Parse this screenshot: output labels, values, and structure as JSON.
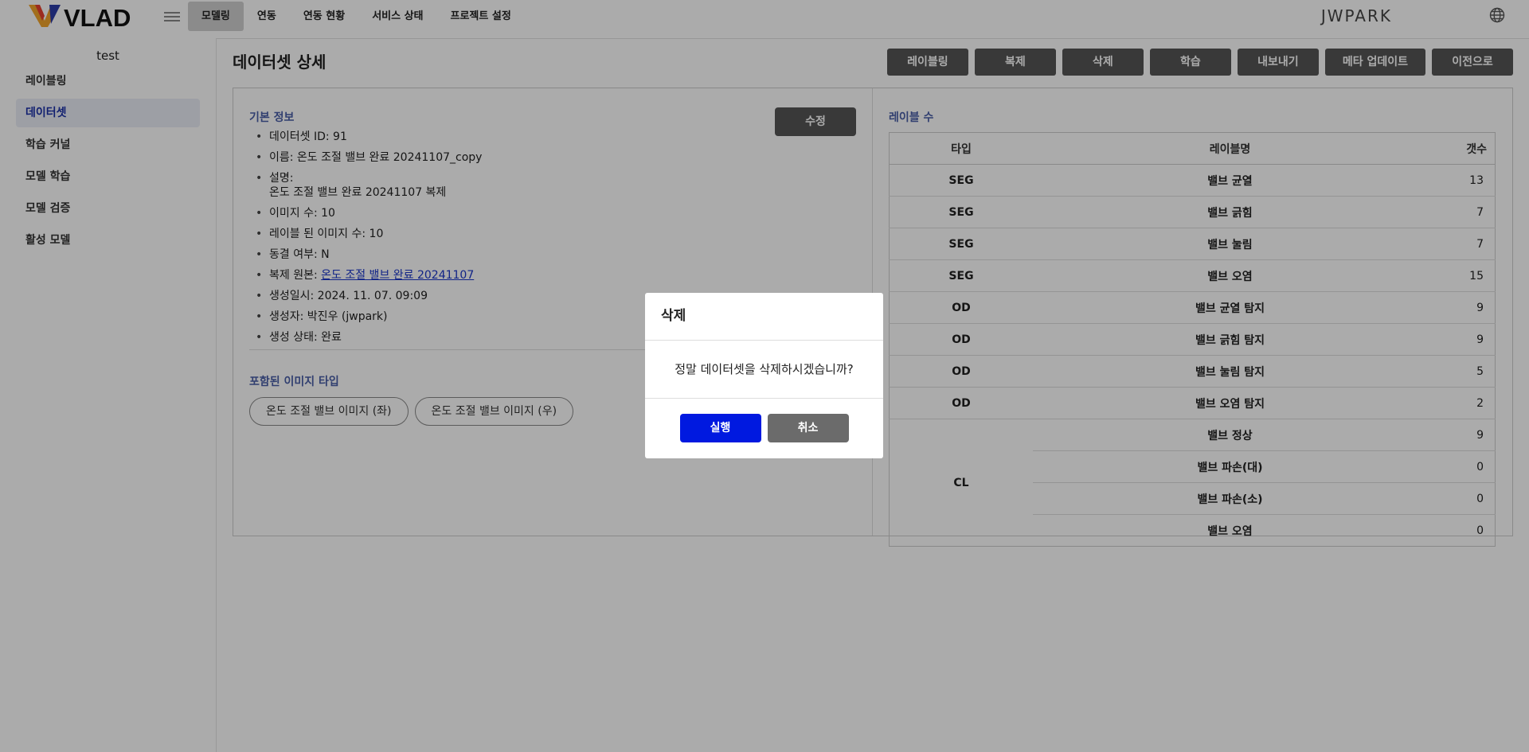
{
  "header": {
    "logo_text": "VLAD",
    "nav": [
      "모델링",
      "연동",
      "연동 현황",
      "서비스 상태",
      "프로젝트 설정"
    ],
    "user": "JWPARK"
  },
  "sidebar": {
    "project": "test",
    "items": [
      {
        "label": "레이블링"
      },
      {
        "label": "데이터셋"
      },
      {
        "label": "학습 커널"
      },
      {
        "label": "모델 학습"
      },
      {
        "label": "모델 검증"
      },
      {
        "label": "활성 모델"
      }
    ]
  },
  "page": {
    "title": "데이터셋 상세",
    "actions": [
      "레이블링",
      "복제",
      "삭제",
      "학습",
      "내보내기",
      "메타 업데이트",
      "이전으로"
    ]
  },
  "info": {
    "section_label": "기본 정보",
    "edit_label": "수정",
    "rows": [
      {
        "label": "데이터셋 ID: 91"
      },
      {
        "label": "이름: 온도 조절 밸브 완료 20241107_copy"
      },
      {
        "label": "설명:",
        "detail": "온도 조절 밸브 완료 20241107 복제"
      },
      {
        "label": "이미지 수: 10"
      },
      {
        "label": "레이블 된 이미지 수: 10"
      },
      {
        "label": "동결 여부: N"
      },
      {
        "label": "복제 원본: ",
        "link": "온도 조절 밸브 완료 20241107"
      },
      {
        "label": "생성일시: 2024. 11. 07. 09:09"
      },
      {
        "label": "생성자: 박진우 (jwpark)"
      },
      {
        "label": "생성 상태: 완료"
      }
    ],
    "image_types_label": "포함된 이미지 타입",
    "image_types": [
      "온도 조절 밸브 이미지 (좌)",
      "온도 조절 밸브 이미지 (우)"
    ]
  },
  "labels": {
    "section_label": "레이블 수",
    "headers": {
      "type": "타입",
      "name": "레이블명",
      "count": "갯수"
    },
    "rows": [
      {
        "type": "SEG",
        "name": "밸브 균열",
        "count": "13"
      },
      {
        "type": "SEG",
        "name": "밸브 긁힘",
        "count": "7"
      },
      {
        "type": "SEG",
        "name": "밸브 눌림",
        "count": "7"
      },
      {
        "type": "SEG",
        "name": "밸브 오염",
        "count": "15"
      },
      {
        "type": "OD",
        "name": "밸브 균열 탐지",
        "count": "9"
      },
      {
        "type": "OD",
        "name": "밸브 긁힘 탐지",
        "count": "9"
      },
      {
        "type": "OD",
        "name": "밸브 눌림 탐지",
        "count": "5"
      },
      {
        "type": "OD",
        "name": "밸브 오염 탐지",
        "count": "2"
      },
      {
        "type": "CL",
        "name": "밸브 정상",
        "count": "9"
      },
      {
        "type": "",
        "name": "밸브 파손(대)",
        "count": "0"
      },
      {
        "type": "",
        "name": "밸브 파손(소)",
        "count": "0"
      },
      {
        "type": "",
        "name": "밸브 오염",
        "count": "0"
      }
    ]
  },
  "modal": {
    "title": "삭제",
    "message": "정말 데이터셋을 삭제하시겠습니까?",
    "confirm": "실행",
    "cancel": "취소"
  },
  "colors": {
    "accent": "#1a2fa8",
    "execute": "#0019e0",
    "button": "#555555"
  }
}
